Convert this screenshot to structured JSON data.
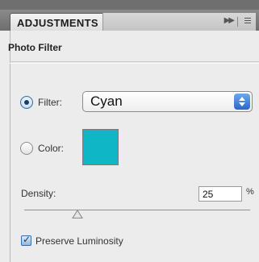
{
  "tab": {
    "label": "ADJUSTMENTS"
  },
  "panel": {
    "title": "Photo Filter"
  },
  "filter": {
    "label": "Filter:",
    "selected": "Cyan",
    "mode_selected": true
  },
  "color": {
    "label": "Color:",
    "swatch_hex": "#0fb6c6"
  },
  "density": {
    "label": "Density:",
    "value": "25",
    "unit": "%",
    "level": 0.25
  },
  "preserve": {
    "label": "Preserve Luminosity",
    "checked": true
  },
  "icons": [
    "fast-forward-icon",
    "panel-menu-icon",
    "select-arrows-icon"
  ]
}
